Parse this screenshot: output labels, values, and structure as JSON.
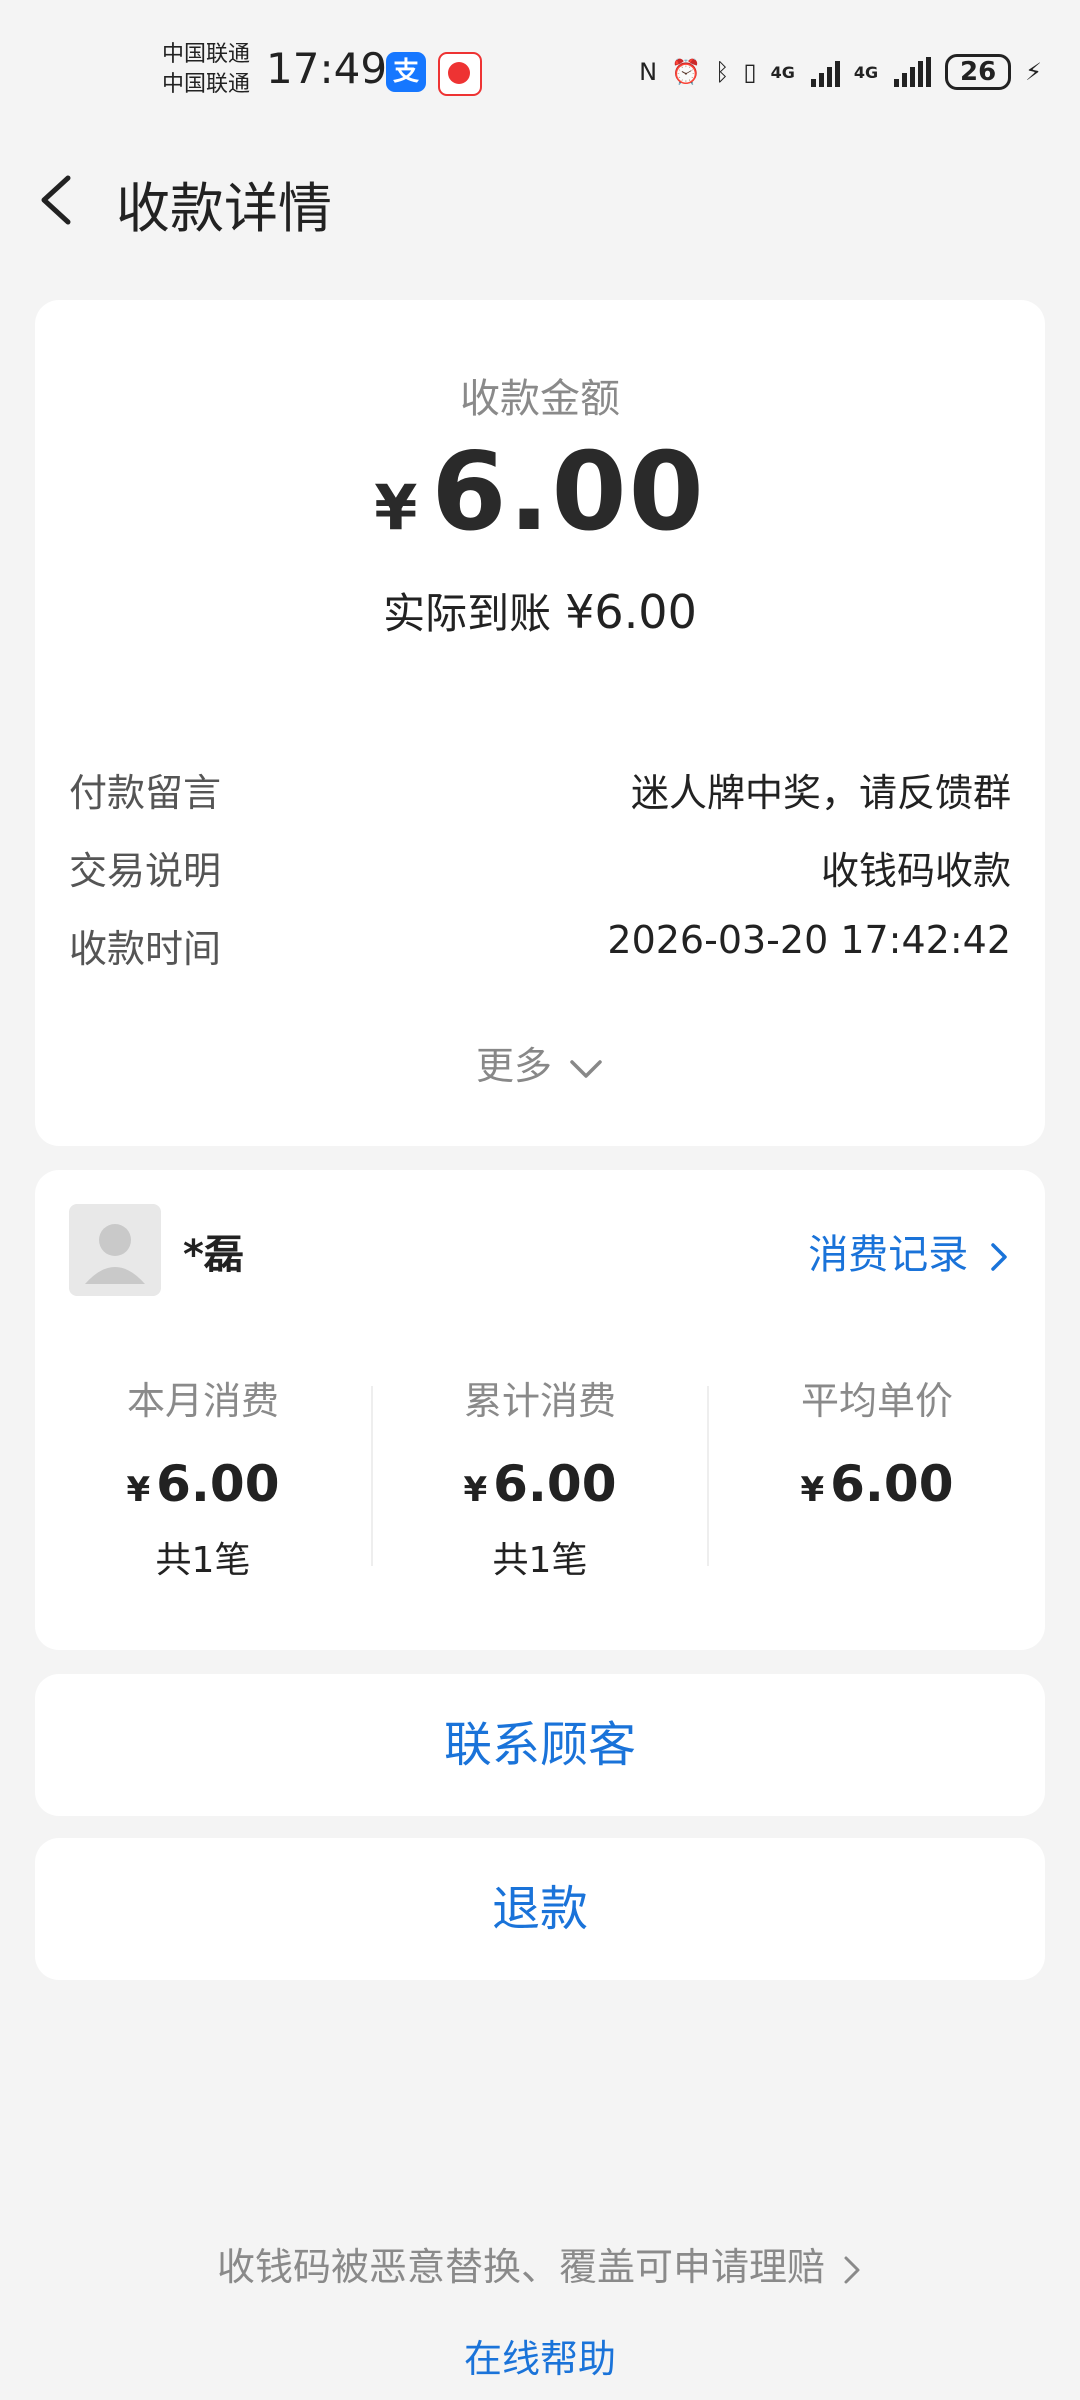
{
  "status": {
    "carrier1": "中国联通",
    "carrier2": "中国联通",
    "time": "17:49",
    "net1": "4G",
    "net2": "4G",
    "battery": "26"
  },
  "header": {
    "title": "收款详情"
  },
  "summary": {
    "amount_label": "收款金额",
    "currency": "¥",
    "amount": "6.00",
    "actual_label": "实际到账",
    "actual_value": "¥6.00"
  },
  "details": [
    {
      "key": "付款留言",
      "value": "迷人牌中奖，请反馈群"
    },
    {
      "key": "交易说明",
      "value": "收钱码收款"
    },
    {
      "key": "收款时间",
      "value": "2026-03-20 17:42:42"
    }
  ],
  "more_label": "更多",
  "customer": {
    "name": "*磊",
    "records_link": "消费记录",
    "stats": [
      {
        "label": "本月消费",
        "currency": "¥",
        "value": "6.00",
        "count": "共1笔"
      },
      {
        "label": "累计消费",
        "currency": "¥",
        "value": "6.00",
        "count": "共1笔"
      },
      {
        "label": "平均单价",
        "currency": "¥",
        "value": "6.00",
        "count": ""
      }
    ]
  },
  "actions": {
    "contact": "联系顾客",
    "refund": "退款"
  },
  "footer": {
    "claim": "收钱码被恶意替换、覆盖可申请理赔",
    "help": "在线帮助"
  },
  "colors": {
    "accent": "#1a73d9",
    "background": "#f4f4f4"
  }
}
